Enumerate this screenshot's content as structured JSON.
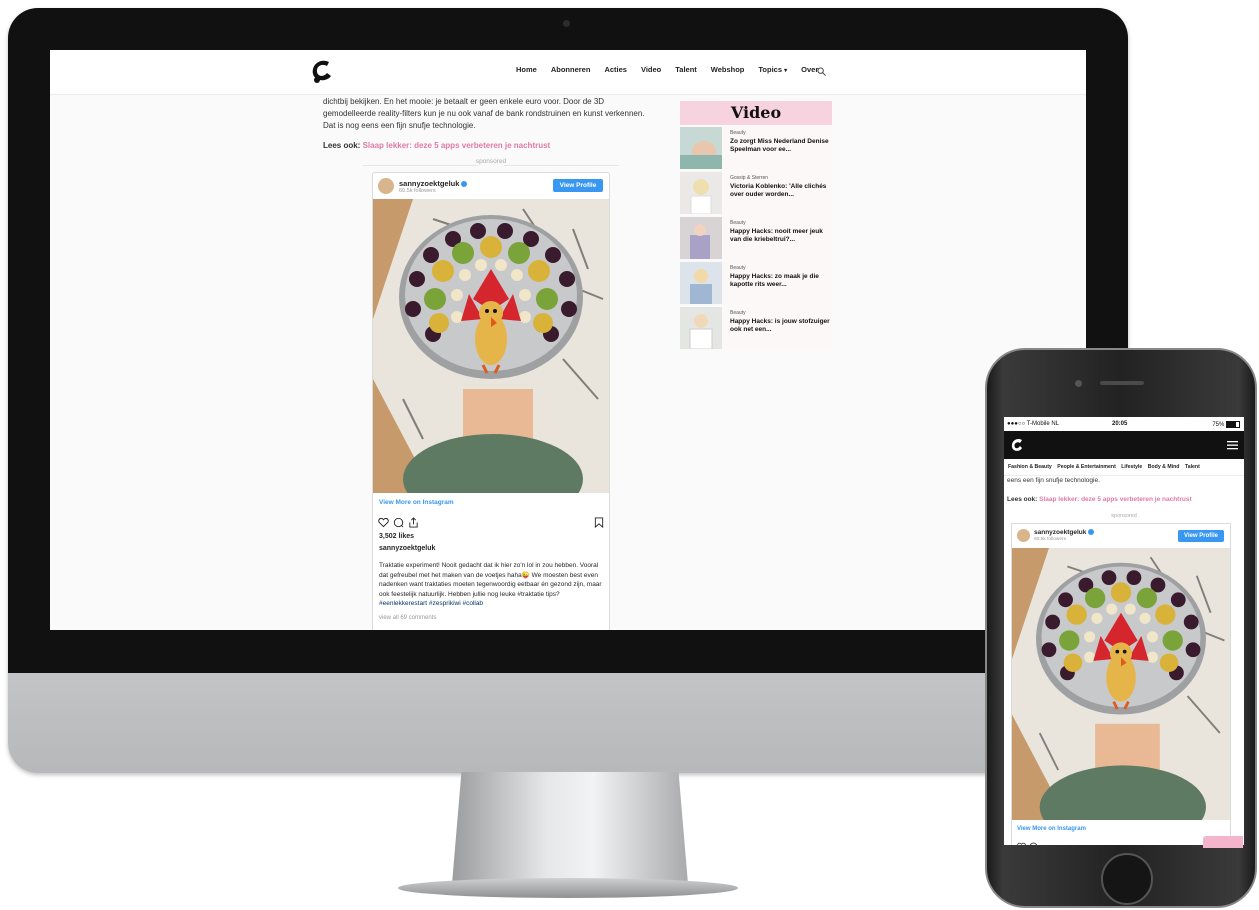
{
  "desktop": {
    "nav": {
      "items": [
        "Home",
        "Abonneren",
        "Acties",
        "Video",
        "Talent",
        "Webshop",
        "Topics",
        "Over"
      ]
    },
    "article": {
      "paragraph": "dichtbij bekijken. En het mooie: je betaalt er geen enkele euro voor. Door de 3D gemodelleerde reality-filters kun je nu ook vanaf de bank rondstruinen en kunst verkennen. Dat is nog eens een fijn snufje technologie.",
      "read_more_label": "Lees ook:",
      "read_more_link": "Slaap lekker: deze 5 apps verbeteren je nachtrust",
      "sponsored": "sponsored"
    },
    "instagram": {
      "username": "sannyzoektgeluk",
      "followers": "60.5k followers",
      "view_profile": "View Profile",
      "view_more": "View More on Instagram",
      "likes": "3,502 likes",
      "caption_user": "sannyzoektgeluk",
      "caption": "Traktatie experiment! Nooit gedacht dat ik hier zo'n lol in zou hebben. Vooral dat gefreubel met het maken van de voetjes haha😜 We moesten best even nadenken want traktaties moeten tegenwoordig eetbaar én gezond zijn, maar ook feestelijk natuurlijk. Hebben jullie nog leuke #traktatie tips?",
      "tags": "#eenlekkerestart #zespri​kiwi #collab",
      "comments": "view all 69 comments"
    },
    "sidebar": {
      "title": "Video",
      "items": [
        {
          "category": "Beauty",
          "headline": "Zo zorgt Miss Nederland Denise Speelman voor ee..."
        },
        {
          "category": "Gossip & Sterren",
          "headline": "Victoria Koblenko: 'Alle clichés over ouder worden..."
        },
        {
          "category": "Beauty",
          "headline": "Happy Hacks: nooit meer jeuk van die kriebeltrui?..."
        },
        {
          "category": "Beauty",
          "headline": "Happy Hacks: zo maak je die kapotte rits weer..."
        },
        {
          "category": "Beauty",
          "headline": "Happy Hacks: is jouw stofzuiger ook net een..."
        }
      ]
    }
  },
  "mobile": {
    "status": {
      "carrier": "●●●○○ T-Mobile NL",
      "time": "20:05",
      "battery": "75%"
    },
    "categories": [
      "Fashion & Beauty",
      "People & Entertainment",
      "Lifestyle",
      "Body & Mind",
      "Talent"
    ],
    "article_text": "eens een fijn snufje technologie.",
    "read_more_label": "Lees ook:",
    "read_more_link": "Slaap lekker: deze 5 apps verbeteren je nachtrust",
    "sponsored": "sponsored",
    "instagram": {
      "username": "sannyzoektgeluk",
      "followers": "60.5k followers",
      "view_profile": "View Profile",
      "view_more": "View More on Instagram"
    }
  },
  "colors": {
    "accent_pink": "#e07aa4",
    "sidebar_title_bg": "#f7d2df",
    "instagram_blue": "#3897f0"
  },
  "icons": [
    "logo-icon",
    "search-icon",
    "chevron-down-icon",
    "heart-icon",
    "comment-icon",
    "share-icon",
    "bookmark-icon",
    "verified-icon",
    "hamburger-menu-icon"
  ]
}
